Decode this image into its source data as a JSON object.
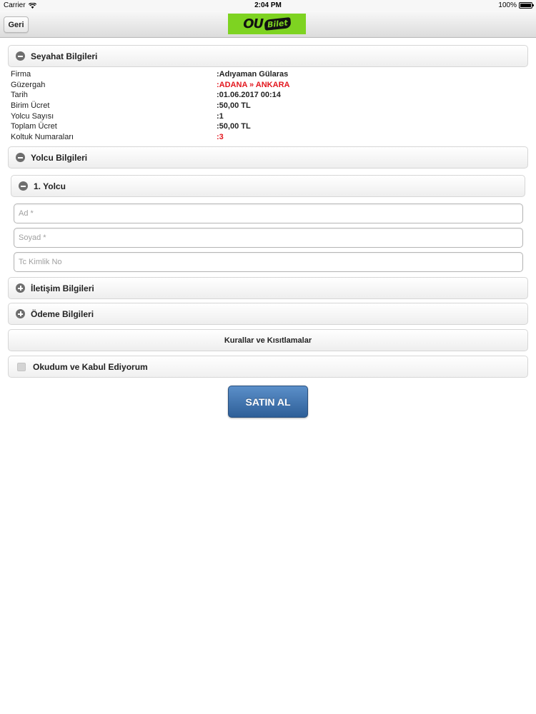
{
  "status_bar": {
    "carrier": "Carrier",
    "time": "2:04 PM",
    "battery": "100%",
    "battery_level": 1.0,
    "wifi_icon": "wifi-icon"
  },
  "nav": {
    "back_label": "Geri",
    "logo": {
      "text_ou": "OU",
      "text_bilet": "Bilet",
      "brand_color": "#7ed321"
    }
  },
  "travel_section": {
    "title": "Seyahat Bilgileri",
    "icon": "minus-circle-icon",
    "rows": [
      {
        "label": "Firma",
        "value": ":Adıyaman Gülaras",
        "highlight": false
      },
      {
        "label": "Güzergah",
        "value": ":ADANA » ANKARA",
        "highlight": true
      },
      {
        "label": "Tarih",
        "value": ":01.06.2017 00:14",
        "highlight": false
      },
      {
        "label": "Birim Ücret",
        "value": ":50,00 TL",
        "highlight": false
      },
      {
        "label": "Yolcu Sayısı",
        "value": ":1",
        "highlight": false
      },
      {
        "label": "Toplam Ücret",
        "value": ":50,00 TL",
        "highlight": false
      },
      {
        "label": "Koltuk Numaraları",
        "value": ":3",
        "highlight": true
      }
    ]
  },
  "passenger_section": {
    "title": "Yolcu Bilgileri",
    "icon": "minus-circle-icon",
    "passenger": {
      "title": "1. Yolcu",
      "icon": "minus-circle-icon",
      "fields": {
        "first_name_placeholder": "Ad *",
        "last_name_placeholder": "Soyad *",
        "tc_placeholder": "Tc Kimlik No"
      }
    }
  },
  "contact_section": {
    "title": "İletişim Bilgileri",
    "icon": "plus-circle-icon"
  },
  "payment_section": {
    "title": "Ödeme Bilgileri",
    "icon": "plus-circle-icon"
  },
  "rules_button": "Kurallar ve Kısıtlamalar",
  "agreement": {
    "label": "Okudum ve Kabul Ediyorum",
    "checked": false
  },
  "buy_button": "SATIN AL",
  "colors": {
    "highlight_red": "#e3161d",
    "buy_button": "#3b6faa",
    "icon_gray": "#6e6e6e"
  }
}
